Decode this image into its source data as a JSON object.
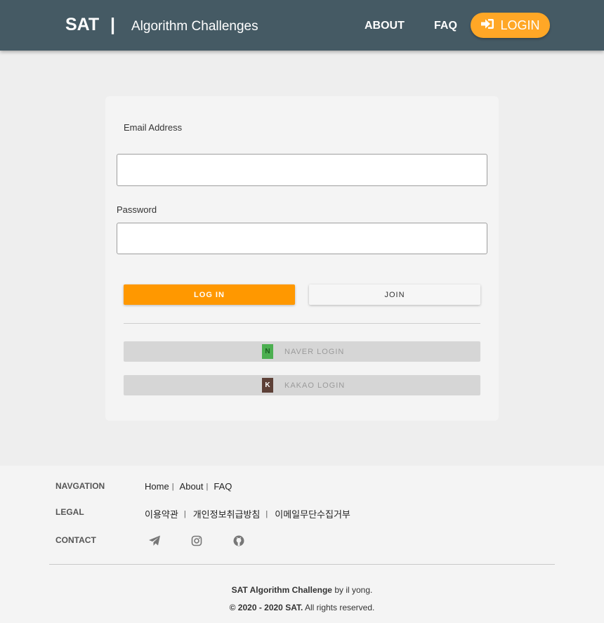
{
  "header": {
    "brand": "SAT",
    "separator": "|",
    "subtitle": "Algorithm Challenges",
    "nav": {
      "about": "ABOUT",
      "faq": "FAQ",
      "login": "LOGIN"
    },
    "login_icon": "sign-in-icon",
    "color": "#455a64",
    "accent": "#ffa726"
  },
  "form": {
    "email_label": "Email Address",
    "email_value": "",
    "password_label": "Password",
    "password_value": "",
    "login_button": "LOG IN",
    "join_button": "JOIN",
    "naver": {
      "badge": "N",
      "label": "NAVER LOGIN"
    },
    "kakao": {
      "badge": "K",
      "label": "KAKAO LOGIN"
    },
    "login_button_color": "#ff9800"
  },
  "footer": {
    "navigation": {
      "heading": "NAVGATION",
      "links": [
        "Home",
        "About",
        "FAQ"
      ],
      "separator": "|"
    },
    "legal": {
      "heading": "LEGAL",
      "links": [
        "이용약관",
        "개인정보취급방침",
        "이메일무단수집거부"
      ],
      "separator": "|"
    },
    "contact": {
      "heading": "CONTACT",
      "icons": [
        "telegram-icon",
        "instagram-icon",
        "github-icon"
      ]
    },
    "credit": {
      "title": "SAT Algorithm Challenge",
      "by": "by il yong."
    },
    "copyright": {
      "years": "© 2020 - 2020 SAT.",
      "rights": "All rights reserved."
    }
  }
}
